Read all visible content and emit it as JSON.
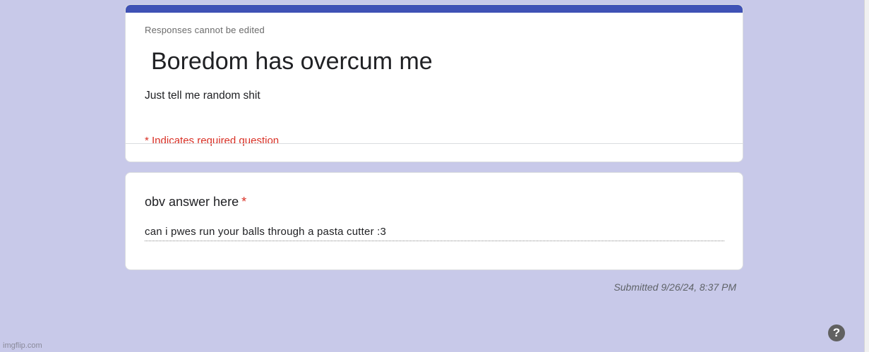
{
  "form": {
    "notice": "Responses cannot be edited",
    "title": "Boredom has overcum me",
    "description": "Just tell me random shit",
    "required_note": "* Indicates required question",
    "accent_color": "#3f51b5",
    "background_color": "#c8c9e9"
  },
  "question": {
    "title": "obv answer here",
    "required_marker": "*",
    "answer": "can i pwes run your balls through a pasta cutter :3"
  },
  "footer": {
    "submitted": "Submitted 9/26/24, 8:37 PM",
    "help_icon": "?",
    "help_icon_name": "help-icon",
    "watermark": "imgflip.com"
  }
}
